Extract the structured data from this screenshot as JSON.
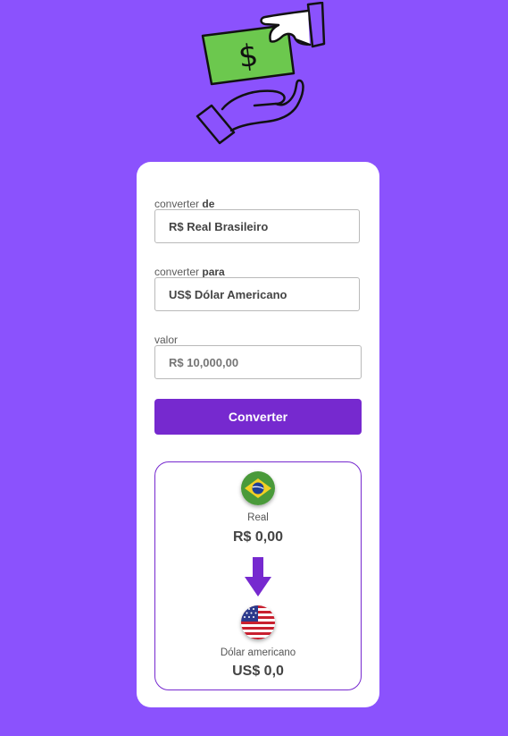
{
  "hero": {
    "icon": "money-hand-icon",
    "symbol": "$"
  },
  "form": {
    "from": {
      "label_prefix": "converter ",
      "label_strong": "de",
      "value": "R$ Real Brasileiro"
    },
    "to": {
      "label_prefix": "converter ",
      "label_strong": "para",
      "value": "US$ Dólar Americano"
    },
    "amount": {
      "label": "valor",
      "placeholder": "R$ 10,000,00"
    },
    "button_label": "Converter"
  },
  "result": {
    "source": {
      "flag_icon": "brazil-flag-icon",
      "name": "Real",
      "value": "R$ 0,00"
    },
    "arrow_icon": "arrow-down-icon",
    "target": {
      "flag_icon": "usa-flag-icon",
      "name": "Dólar americano",
      "value": "US$ 0,0"
    }
  },
  "colors": {
    "background": "#8b52fd",
    "accent": "#7629cf",
    "card": "#ffffff",
    "bill": "#6cc84e"
  }
}
